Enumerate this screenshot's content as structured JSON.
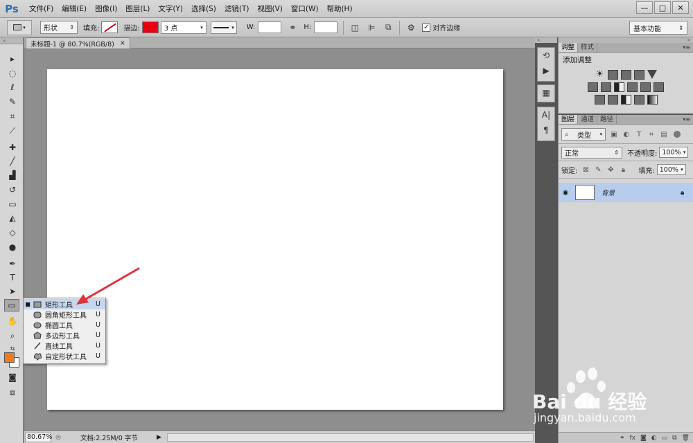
{
  "app": {
    "logo": "Ps"
  },
  "menu": [
    "文件(F)",
    "编辑(E)",
    "图像(I)",
    "图层(L)",
    "文字(Y)",
    "选择(S)",
    "滤镜(T)",
    "视图(V)",
    "窗口(W)",
    "帮助(H)"
  ],
  "window_controls": {
    "minimize": "—",
    "restore": "□",
    "close": "✕"
  },
  "options": {
    "mode": "形状",
    "fill_label": "填充:",
    "stroke_label": "描边:",
    "stroke_width": "3 点",
    "w_label": "W:",
    "h_label": "H:",
    "align_edges_label": "对齐边缘",
    "align_edges_checked": true,
    "workspace": "基本功能",
    "stroke_color": "#e60012"
  },
  "document": {
    "tab_title": "未标题-1 @ 80.7%(RGB/8)",
    "tab_close": "×"
  },
  "statusbar": {
    "zoom": "80.67%",
    "doc_info": "文档:2.25M/0 字节"
  },
  "flyout": {
    "items": [
      {
        "label": "矩形工具",
        "key": "U",
        "icon": "rectangle-icon",
        "selected": true
      },
      {
        "label": "圆角矩形工具",
        "key": "U",
        "icon": "rounded-rectangle-icon",
        "selected": false
      },
      {
        "label": "椭圆工具",
        "key": "U",
        "icon": "ellipse-icon",
        "selected": false
      },
      {
        "label": "多边形工具",
        "key": "U",
        "icon": "polygon-icon",
        "selected": false
      },
      {
        "label": "直线工具",
        "key": "U",
        "icon": "line-icon",
        "selected": false
      },
      {
        "label": "自定形状工具",
        "key": "U",
        "icon": "custom-shape-icon",
        "selected": false
      }
    ]
  },
  "colors": {
    "foreground": "#f07b1f",
    "background": "#ffffff",
    "arrow": "#d9363e"
  },
  "adjustments_panel": {
    "tabs": [
      "调整",
      "样式"
    ],
    "title": "添加调整"
  },
  "layers_panel": {
    "tabs": [
      "图层",
      "通道",
      "路径"
    ],
    "kind": "类型",
    "blend_mode": "正常",
    "opacity_label": "不透明度:",
    "opacity": "100%",
    "lock_label": "锁定:",
    "fill_label": "填充:",
    "fill": "100%",
    "layer_name": "背景",
    "footer_icons": [
      "link-icon",
      "fx-icon",
      "mask-icon",
      "adjustment-layer-icon",
      "group-icon",
      "new-layer-icon",
      "trash-icon"
    ]
  },
  "watermark": {
    "brand": "Bai du 经验",
    "url": "jingyan.baidu.com"
  }
}
